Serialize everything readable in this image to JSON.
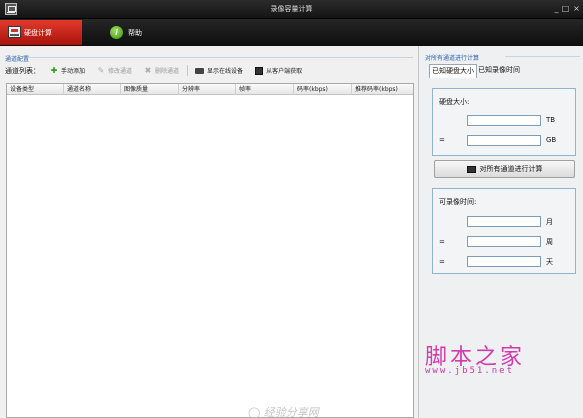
{
  "window": {
    "title": "录像容量计算",
    "min": "_",
    "max": "□",
    "close": "×"
  },
  "tabs": [
    {
      "label": "硬盘计算",
      "icon": "disk-icon",
      "active": true
    },
    {
      "label": "帮助",
      "icon": "help-icon",
      "icon_glyph": "i",
      "active": false
    }
  ],
  "left": {
    "header": "通道配置",
    "list_label": "通道列表：",
    "buttons": [
      {
        "label": "手动添加",
        "icon": "plus-icon",
        "glyph": "✚",
        "enabled": true
      },
      {
        "label": "修改通道",
        "icon": "edit-icon",
        "glyph": "✎",
        "enabled": false
      },
      {
        "label": "删除通道",
        "icon": "delete-icon",
        "glyph": "✖",
        "enabled": false
      },
      {
        "label": "显示在线设备",
        "icon": "device-icon",
        "enabled": true
      },
      {
        "label": "从客户端获取",
        "icon": "fetch-icon",
        "enabled": true
      }
    ],
    "columns": [
      "设备类型",
      "通道名称",
      "图像质量",
      "分辨率",
      "帧率",
      "码率(kbps)",
      "推荐码率(kbps)"
    ]
  },
  "right": {
    "header": "对所有通道进行计算",
    "tabs": [
      "已知硬盘大小",
      "已知录像时间"
    ],
    "disk_group": {
      "title": "硬盘大小:",
      "eq": "=",
      "tb_unit": "TB",
      "gb_unit": "GB",
      "tb_value": "",
      "gb_value": ""
    },
    "calc_button": "对所有通道进行计算",
    "time_group": {
      "title": "可录像时间:",
      "eq": "=",
      "month_unit": "月",
      "week_unit": "周",
      "day_unit": "天",
      "month_value": "",
      "week_value": "",
      "day_value": ""
    }
  },
  "watermark": {
    "brand": "脚本之家",
    "url": "www.jb51.net",
    "faint": "◯ 经验分享网"
  },
  "colors": {
    "accent_red": "#c8201a",
    "header_blue": "#2a5fb0",
    "watermark_pink": "#d23bb0"
  }
}
